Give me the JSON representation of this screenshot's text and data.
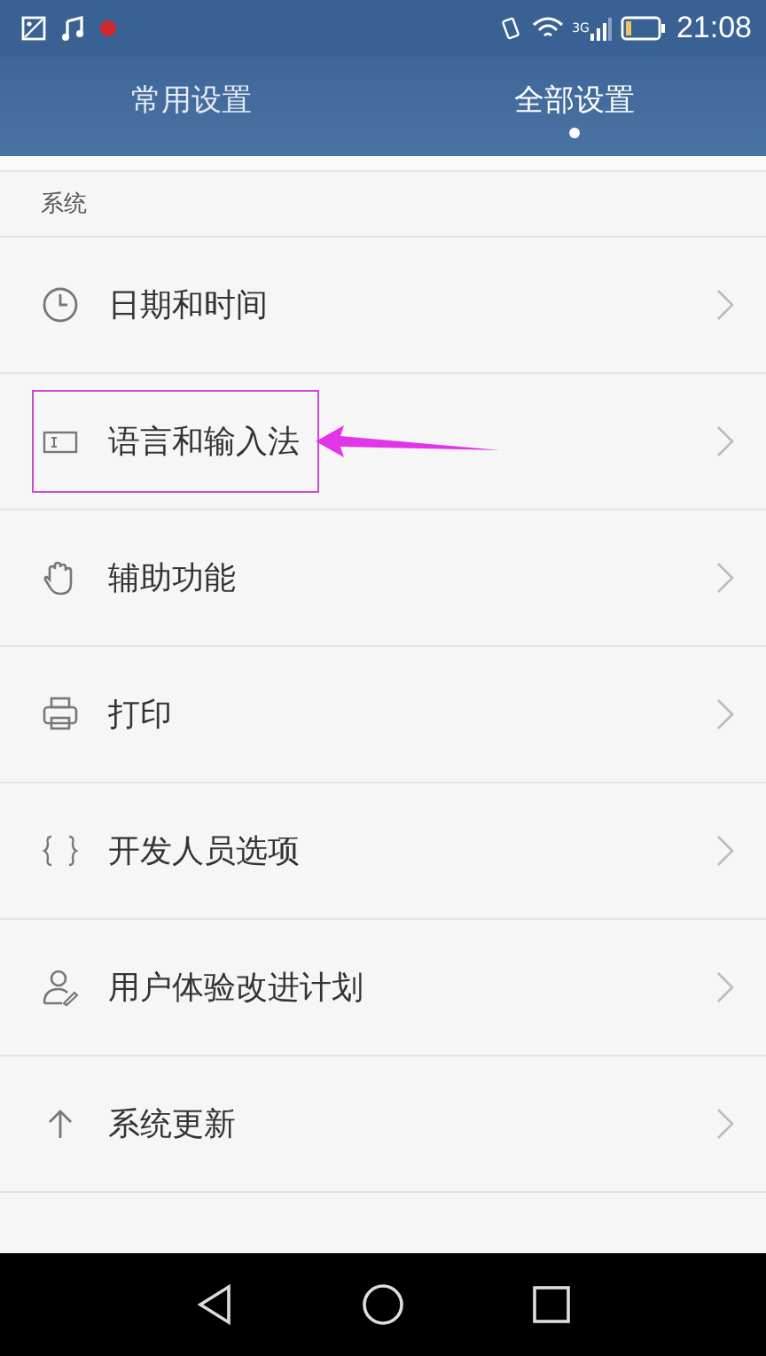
{
  "status_bar": {
    "network_label": "3G",
    "time": "21:08"
  },
  "tabs": [
    {
      "label": "常用设置",
      "selected": false
    },
    {
      "label": "全部设置",
      "selected": true
    }
  ],
  "section": {
    "title": "系统"
  },
  "items": [
    {
      "kind": "clock",
      "label": "日期和时间",
      "highlighted": false
    },
    {
      "kind": "keyboard",
      "label": "语言和输入法",
      "highlighted": true
    },
    {
      "kind": "hand",
      "label": "辅助功能",
      "highlighted": false
    },
    {
      "kind": "printer",
      "label": "打印",
      "highlighted": false
    },
    {
      "kind": "braces",
      "label": "开发人员选项",
      "highlighted": false
    },
    {
      "kind": "user",
      "label": "用户体验改进计划",
      "highlighted": false
    },
    {
      "kind": "arrow-up",
      "label": "系统更新",
      "highlighted": false
    }
  ]
}
